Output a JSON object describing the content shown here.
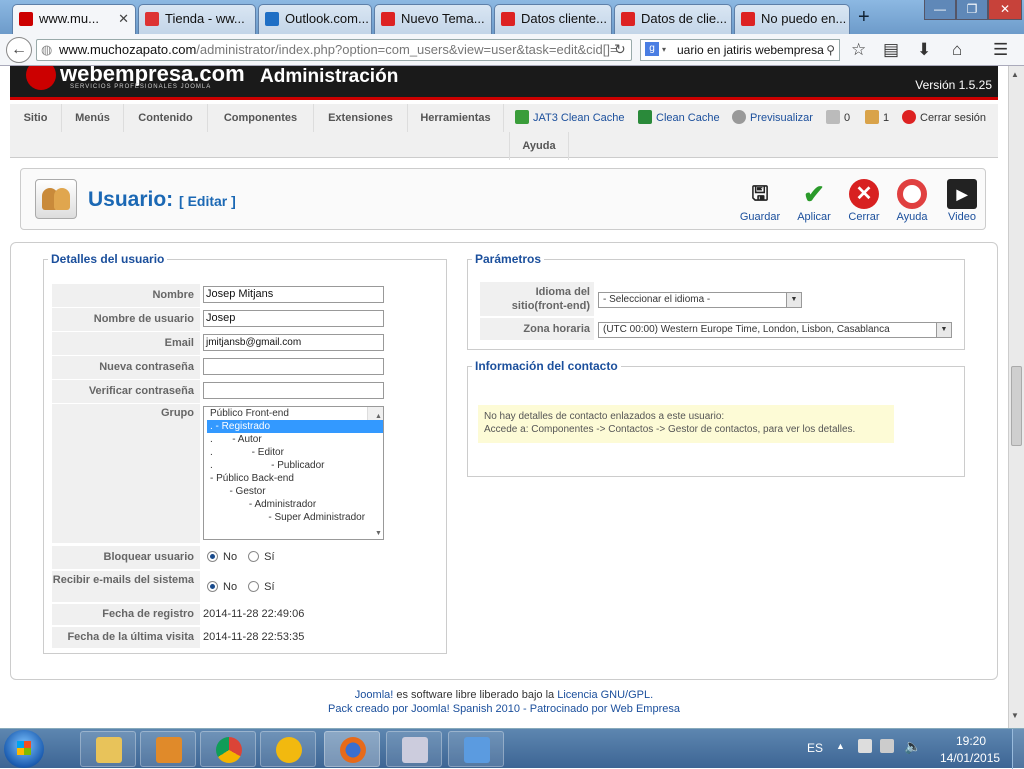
{
  "browser": {
    "tabs": [
      {
        "title": "www.mu...",
        "color": "#c00",
        "active": true
      },
      {
        "title": "Tienda - ww...",
        "color": "#d33"
      },
      {
        "title": "Outlook.com...",
        "color": "#1f6fc5"
      },
      {
        "title": "Nuevo Tema...",
        "color": "#d22"
      },
      {
        "title": "Datos cliente...",
        "color": "#d22"
      },
      {
        "title": "Datos de clie...",
        "color": "#d22"
      },
      {
        "title": "No puedo en...",
        "color": "#d22"
      }
    ],
    "url_host": "www.muchozapato.com",
    "url_rest": "/administrator/index.php?option=com_users&view=user&task=edit&cid[]=",
    "search_text": "uario en jatiris webempresa",
    "window_min": "—",
    "window_max": "❐",
    "window_close": "✕"
  },
  "header": {
    "logo_text": "webempresa.com",
    "logo_sub": "SERVICIOS PROFESIONALES JOOMLA",
    "title": "Administración",
    "version": "Versión 1.5.25"
  },
  "menu": {
    "items": [
      "Sitio",
      "Menús",
      "Contenido",
      "Componentes",
      "Extensiones",
      "Herramientas",
      "Ayuda"
    ],
    "actions": {
      "jat3": "JAT3 Clean Cache",
      "clean_cache": "Clean Cache",
      "preview": "Previsualizar",
      "messages_count": "0",
      "users_count": "1",
      "logout": "Cerrar sesión"
    }
  },
  "toolbar": {
    "title": "Usuario:",
    "subtitle": "[ Editar ]",
    "buttons": {
      "save": "Guardar",
      "apply": "Aplicar",
      "close": "Cerrar",
      "help": "Ayuda",
      "video": "Video"
    }
  },
  "user_details": {
    "legend": "Detalles del usuario",
    "labels": {
      "name": "Nombre",
      "username": "Nombre de usuario",
      "email": "Email",
      "new_password": "Nueva contraseña",
      "verify_password": "Verificar contraseña",
      "group": "Grupo",
      "block": "Bloquear usuario",
      "receive_email": "Recibir e-mails del sistema",
      "register_date": "Fecha de registro",
      "last_visit": "Fecha de la última visita"
    },
    "values": {
      "name": "Josep Mitjans",
      "username": "Josep",
      "email": "jmitjansb@gmail.com",
      "new_password": "",
      "verify_password": "",
      "register_date": "2014-11-28 22:49:06",
      "last_visit": "2014-11-28 22:53:35"
    },
    "groups": [
      {
        "text": "Público Front-end",
        "selected": false
      },
      {
        "text": ". - Registrado",
        "selected": true
      },
      {
        "text": ".       - Autor",
        "selected": false
      },
      {
        "text": ".              - Editor",
        "selected": false
      },
      {
        "text": ".                     - Publicador",
        "selected": false
      },
      {
        "text": "- Público Back-end",
        "selected": false
      },
      {
        "text": "       - Gestor",
        "selected": false
      },
      {
        "text": "              - Administrador",
        "selected": false
      },
      {
        "text": "                     - Super Administrador",
        "selected": false
      }
    ],
    "radio_no": "No",
    "radio_yes": "Sí",
    "block_value": "No",
    "receive_email_value": "No"
  },
  "parameters": {
    "legend": "Parámetros",
    "language_label": "Idioma del sitio(front-end)",
    "language_value": "- Seleccionar el idioma -",
    "timezone_label": "Zona horaria",
    "timezone_value": "(UTC 00:00) Western Europe Time, London, Lisbon, Casablanca"
  },
  "contact_info": {
    "legend": "Información del contacto",
    "line1": "No hay detalles de contacto enlazados a este usuario:",
    "line2": "Accede a: Componentes -> Contactos -> Gestor de contactos, para ver los detalles."
  },
  "footer": {
    "joomla": "Joomla!",
    "text1": " es software libre liberado bajo la ",
    "license": "Licencia GNU/GPL.",
    "line2": "Pack creado por Joomla! Spanish 2010 - Patrocinado por Web Empresa"
  },
  "taskbar": {
    "language": "ES",
    "time": "19:20",
    "date": "14/01/2015"
  }
}
